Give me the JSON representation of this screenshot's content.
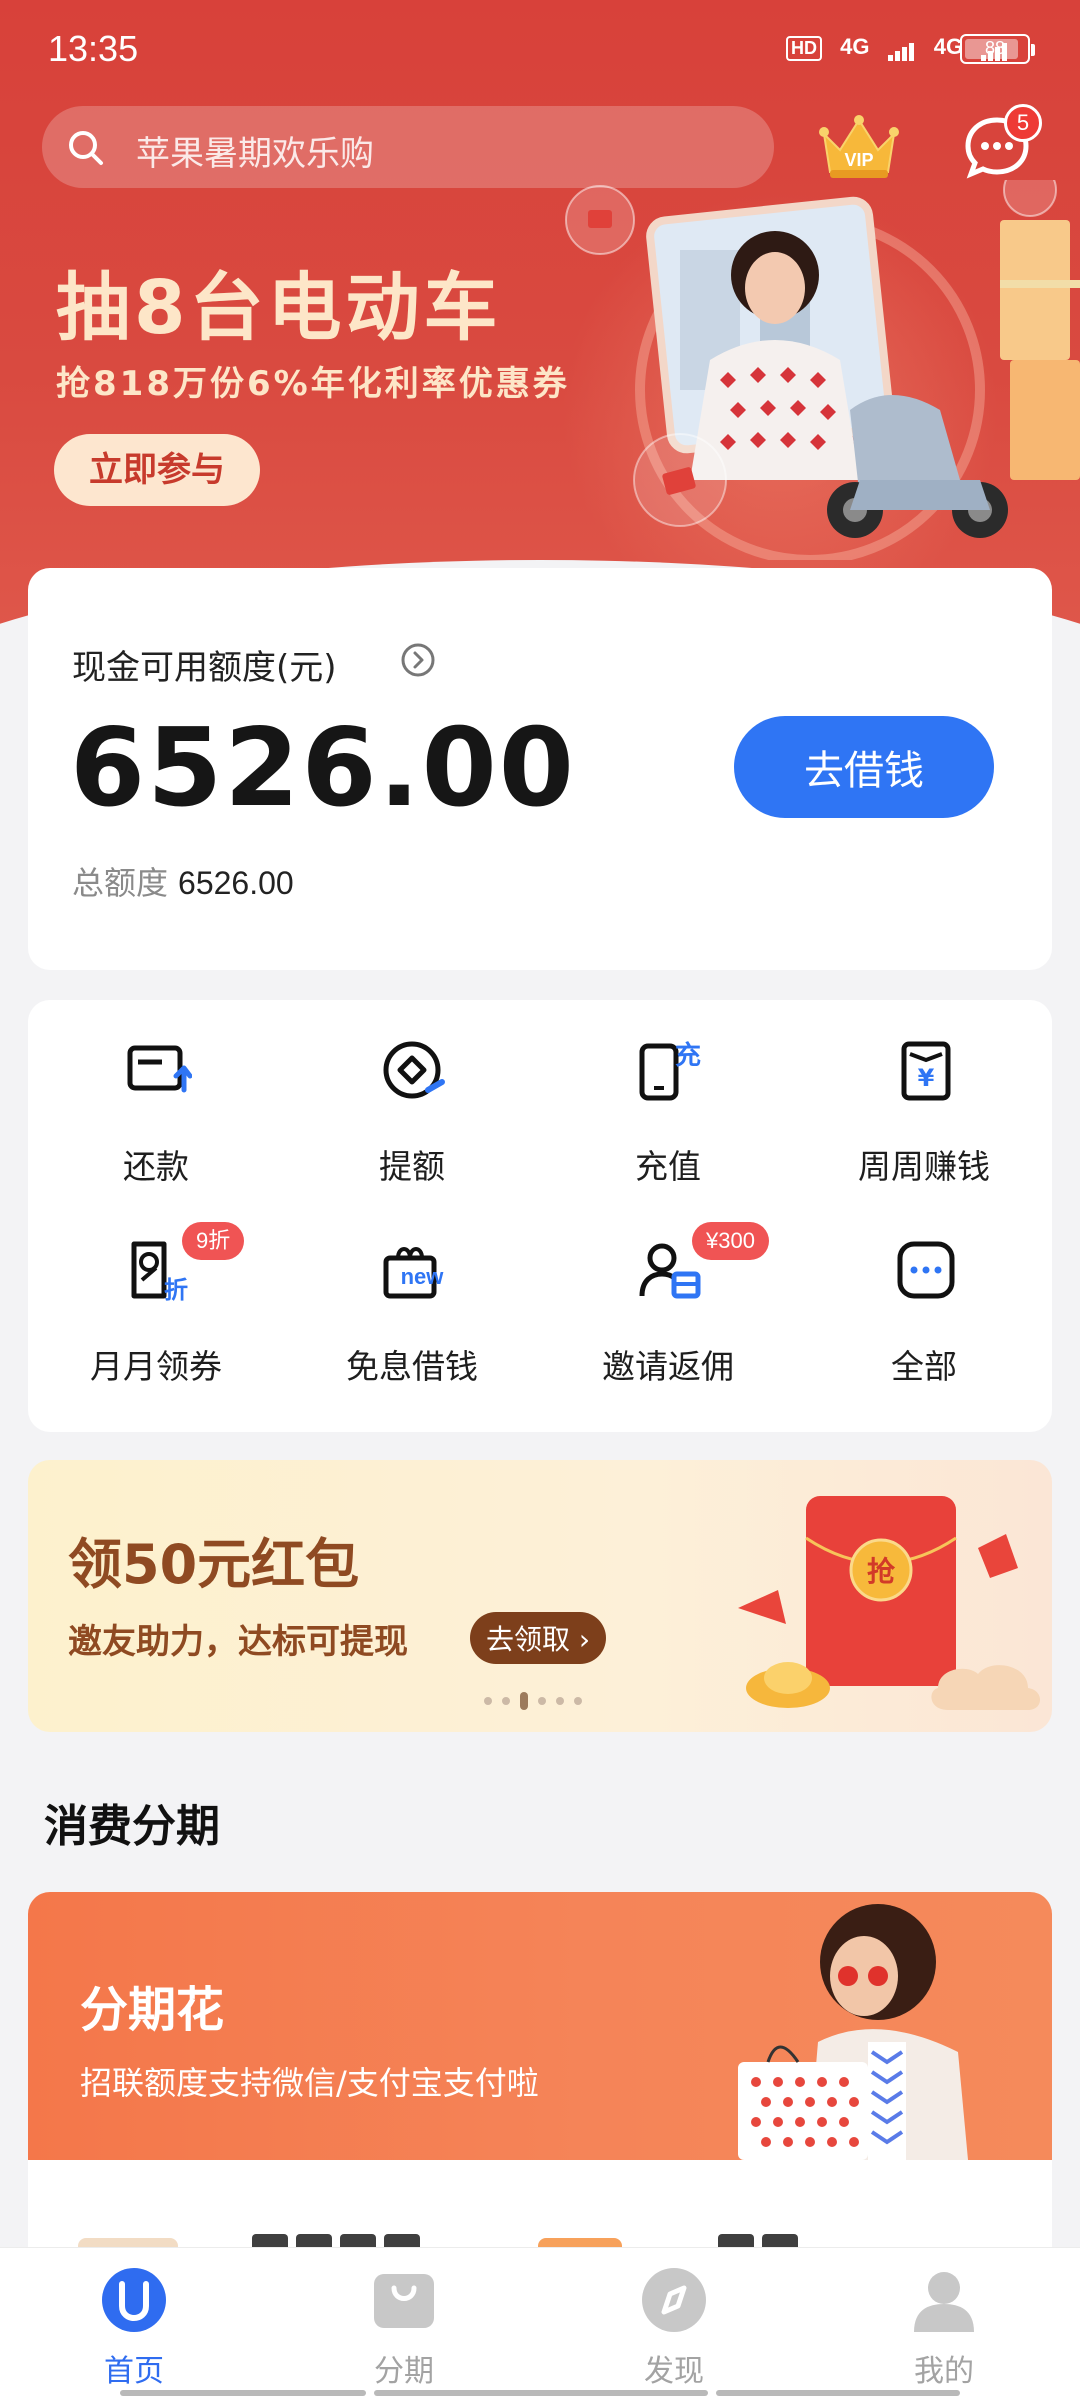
{
  "status_bar": {
    "time": "13:35",
    "hd": "HD",
    "net1": "4G",
    "net2": "4G",
    "battery": "88",
    "battery_level": 0.88
  },
  "header": {
    "search_placeholder": "苹果暑期欢乐购",
    "vip_label": "VIP",
    "message_badge": "5"
  },
  "promo": {
    "title": "抽8台电动车",
    "subtitle": "抢818万份6%年化利率优惠券",
    "button": "立即参与"
  },
  "credit": {
    "label": "现金可用额度(元)",
    "amount": "6526.00",
    "total_label": "总额度",
    "total_value": "6526.00",
    "borrow_button": "去借钱"
  },
  "quick_actions": [
    {
      "label": "还款",
      "icon": "repay-icon"
    },
    {
      "label": "提额",
      "icon": "raise-limit-icon"
    },
    {
      "label": "充值",
      "icon": "recharge-icon"
    },
    {
      "label": "周周赚钱",
      "icon": "weekly-earn-icon"
    },
    {
      "label": "月月领券",
      "icon": "monthly-coupon-icon",
      "tag": "9折"
    },
    {
      "label": "免息借钱",
      "icon": "interest-free-icon",
      "icon_text": "new"
    },
    {
      "label": "邀请返佣",
      "icon": "invite-icon",
      "tag": "¥300"
    },
    {
      "label": "全部",
      "icon": "all-icon"
    }
  ],
  "red_packet_banner": {
    "title": "领50元红包",
    "subtitle": "邀友助力，达标可提现",
    "button": "去领取",
    "packet_char": "抢",
    "carousel_count": 6,
    "carousel_active": 3
  },
  "installment": {
    "section_title": "消费分期",
    "title": "分期花",
    "subtitle": "招联额度支持微信/支付宝支付啦"
  },
  "bottom_nav": [
    {
      "label": "首页",
      "icon": "home-icon",
      "active": true
    },
    {
      "label": "分期",
      "icon": "installment-bag-icon",
      "active": false
    },
    {
      "label": "发现",
      "icon": "compass-icon",
      "active": false
    },
    {
      "label": "我的",
      "icon": "profile-icon",
      "active": false
    }
  ],
  "colors": {
    "hero_red": "#d8413a",
    "primary_blue": "#2f75f4",
    "tag_red": "#f05454",
    "banner_brown": "#8f4a22",
    "installment_orange": "#f4774a"
  }
}
